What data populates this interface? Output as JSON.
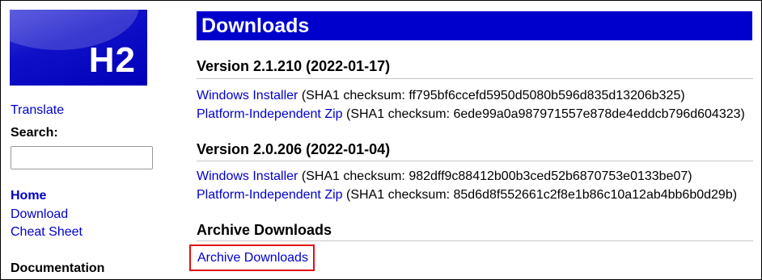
{
  "logo": {
    "text": "H2"
  },
  "sidebar": {
    "translate": "Translate",
    "search_label": "Search:",
    "search_value": "",
    "nav": [
      "Home",
      "Download",
      "Cheat Sheet"
    ],
    "documentation": "Documentation"
  },
  "main": {
    "title": "Downloads",
    "versions": [
      {
        "heading": "Version 2.1.210 (2022-01-17)",
        "downloads": [
          {
            "link": "Windows Installer",
            "checksum": "(SHA1 checksum: ff795bf6ccefd5950d5080b596d835d13206b325)"
          },
          {
            "link": "Platform-Independent Zip",
            "checksum": "(SHA1 checksum: 6ede99a0a987971557e878de4eddcb796d604323)"
          }
        ]
      },
      {
        "heading": "Version 2.0.206 (2022-01-04)",
        "downloads": [
          {
            "link": "Windows Installer",
            "checksum": "(SHA1 checksum: 982dff9c88412b00b3ced52b6870753e0133be07)"
          },
          {
            "link": "Platform-Independent Zip",
            "checksum": "(SHA1 checksum: 85d6d8f552661c2f8e1b86c10a12ab4bb6b0d29b)"
          }
        ]
      }
    ],
    "archive_heading": "Archive Downloads",
    "archive_link": "Archive Downloads"
  },
  "colors": {
    "link": "#0000cc",
    "title_bar": "#0000cc",
    "highlight": "#e01010"
  }
}
